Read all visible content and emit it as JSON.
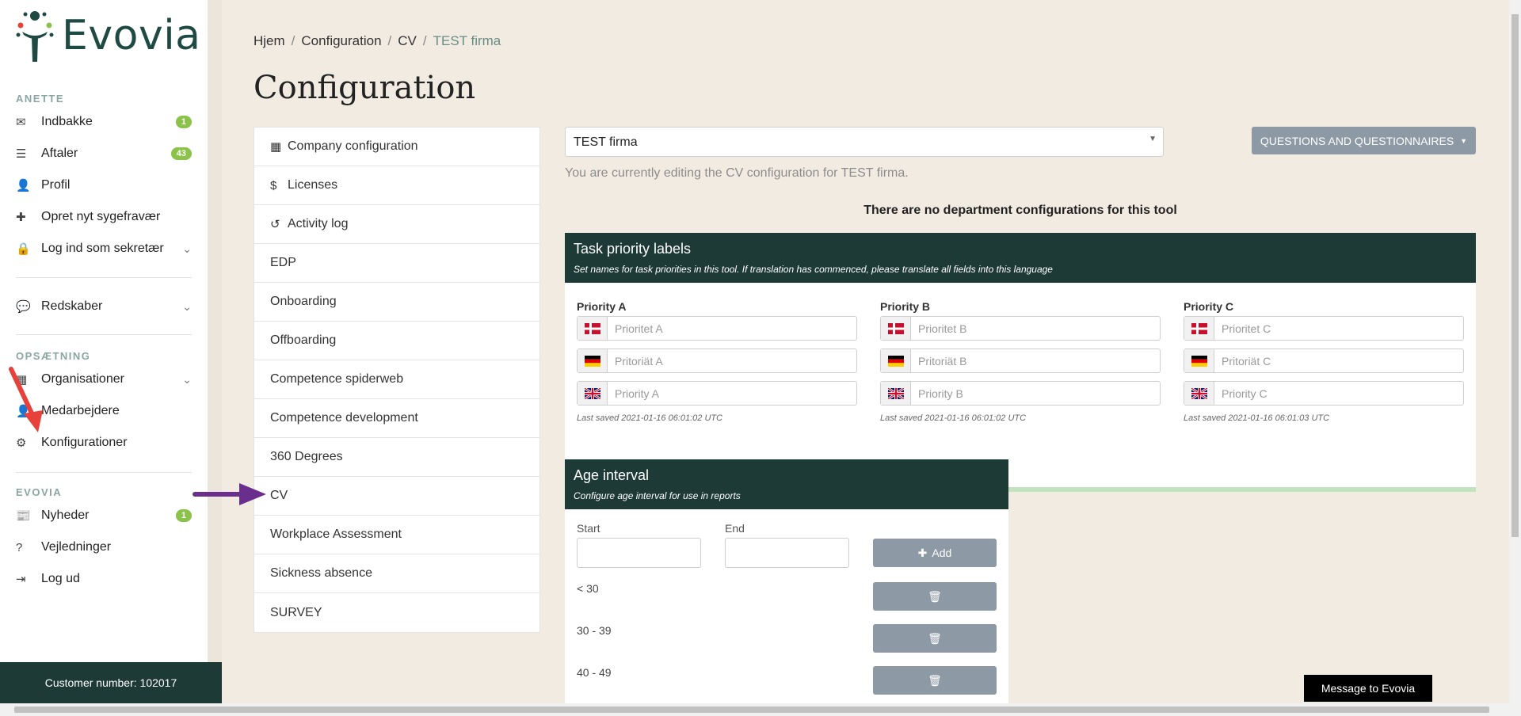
{
  "app": {
    "logo_text": "Evovia"
  },
  "sidebar": {
    "section_user": "ANETTE",
    "user_items": [
      {
        "label": "Indbakke",
        "badge": "1",
        "icon": "envelope-icon"
      },
      {
        "label": "Aftaler",
        "badge": "43",
        "icon": "list-icon"
      },
      {
        "label": "Profil",
        "icon": "user-icon"
      },
      {
        "label": "Opret nyt sygefravær",
        "icon": "plus-icon"
      },
      {
        "label": "Log ind som sekretær",
        "icon": "lock-icon",
        "expandable": true
      }
    ],
    "tools_item": {
      "label": "Redskaber",
      "icon": "speech-bubble-icon"
    },
    "section_setup": "OPSÆTNING",
    "setup_items": [
      {
        "label": "Organisationer",
        "icon": "building-icon"
      },
      {
        "label": "Medarbejdere",
        "icon": "user-icon"
      },
      {
        "label": "Konfigurationer",
        "icon": "gear-icon"
      }
    ],
    "section_evovia": "EVOVIA",
    "evovia_items": [
      {
        "label": "Nyheder",
        "badge": "1",
        "icon": "newspaper-icon"
      },
      {
        "label": "Vejledninger",
        "icon": "question-icon"
      },
      {
        "label": "Log ud",
        "icon": "sign-out-icon"
      }
    ],
    "customer_number": "Customer number: 102017"
  },
  "breadcrumb": {
    "items": [
      "Hjem",
      "Configuration",
      "CV"
    ],
    "current": "TEST firma"
  },
  "page": {
    "title": "Configuration"
  },
  "config_nav": [
    {
      "label": "Company configuration",
      "icon": "building-icon"
    },
    {
      "label": "Licenses",
      "icon": "dollar-icon"
    },
    {
      "label": "Activity log",
      "icon": "history-icon"
    },
    {
      "label": "EDP"
    },
    {
      "label": "Onboarding"
    },
    {
      "label": "Offboarding"
    },
    {
      "label": "Competence spiderweb"
    },
    {
      "label": "Competence development"
    },
    {
      "label": "360 Degrees"
    },
    {
      "label": "CV"
    },
    {
      "label": "Workplace Assessment"
    },
    {
      "label": "Sickness absence"
    },
    {
      "label": "SURVEY"
    }
  ],
  "firm_select": {
    "value": "TEST firma"
  },
  "questions_button": "QUESTIONS AND QUESTIONNAIRES",
  "editing_note": "You are currently editing the CV configuration for TEST firma.",
  "no_department_notice": "There are no department configurations for this tool",
  "task_priority": {
    "title": "Task priority labels",
    "subtitle": "Set names for task priorities in this tool. If translation has commenced, please translate all fields into this language",
    "columns": [
      {
        "label": "Priority A",
        "da": "Prioritet A",
        "de": "Pritoriät A",
        "en": "Priority A",
        "saved": "Last saved 2021-01-16 06:01:02 UTC"
      },
      {
        "label": "Priority B",
        "da": "Prioritet B",
        "de": "Pritoriät B",
        "en": "Priority B",
        "saved": "Last saved 2021-01-16 06:01:02 UTC"
      },
      {
        "label": "Priority C",
        "da": "Prioritet C",
        "de": "Pritoriät C",
        "en": "Priority C",
        "saved": "Last saved 2021-01-16 06:01:03 UTC"
      }
    ]
  },
  "age_interval": {
    "title": "Age interval",
    "subtitle": "Configure age interval for use in reports",
    "start_label": "Start",
    "end_label": "End",
    "add_label": "Add",
    "ranges": [
      "< 30",
      "30 - 39",
      "40 - 49"
    ]
  },
  "message_button": "Message to Evovia",
  "colors": {
    "brand_dark": "#1d3a36",
    "gray_button": "#8e99a6",
    "badge_green": "#8bc34a",
    "annotation_red": "#e8403a",
    "annotation_purple": "#6a2f8e"
  }
}
